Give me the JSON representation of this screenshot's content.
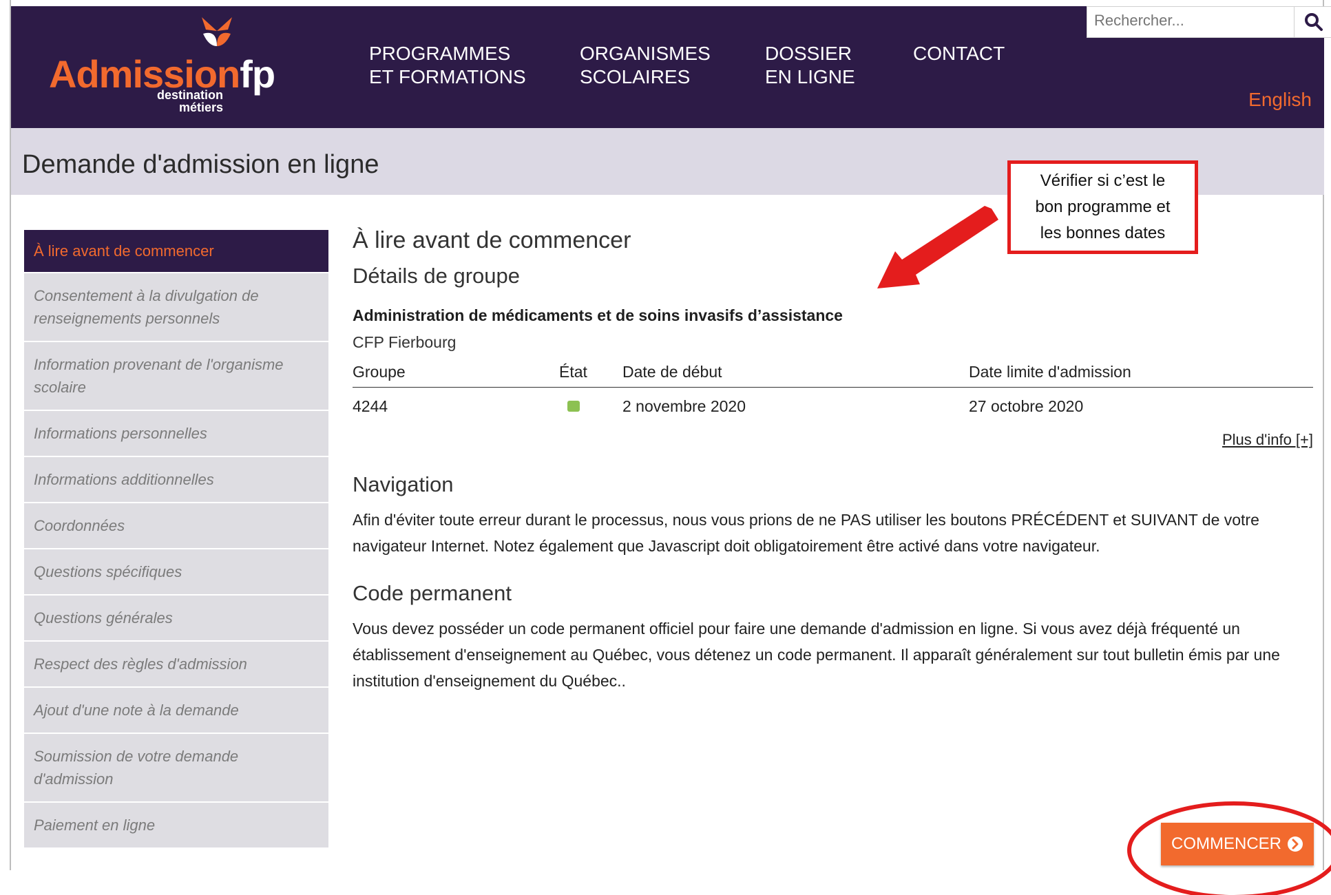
{
  "header": {
    "logo": {
      "word_main": "Admission",
      "word_fp": "fp",
      "sub_line1": "destination",
      "sub_line2": "métiers"
    },
    "nav": [
      {
        "line1": "PROGRAMMES",
        "line2": "ET FORMATIONS"
      },
      {
        "line1": "ORGANISMES",
        "line2": "SCOLAIRES"
      },
      {
        "line1": "DOSSIER",
        "line2": "EN LIGNE"
      },
      {
        "line1": "CONTACT",
        "line2": ""
      }
    ],
    "search": {
      "placeholder": "Rechercher...",
      "icon": "search-icon"
    },
    "language_link": "English",
    "colors": {
      "background": "#2d1b47",
      "accent": "#f26a2e"
    }
  },
  "page_title": "Demande d'admission en ligne",
  "sidebar": {
    "items": [
      {
        "label": "À lire avant de commencer",
        "active": true
      },
      {
        "label": "Consentement à la divulgation de renseignements personnels"
      },
      {
        "label": "Information provenant de l'organisme scolaire"
      },
      {
        "label": "Informations personnelles"
      },
      {
        "label": "Informations additionnelles"
      },
      {
        "label": "Coordonnées"
      },
      {
        "label": "Questions spécifiques"
      },
      {
        "label": "Questions générales"
      },
      {
        "label": "Respect des règles d'admission"
      },
      {
        "label": "Ajout d'une note à la demande"
      },
      {
        "label": "Soumission de votre demande d'admission"
      },
      {
        "label": "Paiement en ligne"
      }
    ]
  },
  "main": {
    "section_title": "À lire avant de commencer",
    "group_title": "Détails de groupe",
    "program_name": "Administration de médicaments et de soins invasifs d’assistance",
    "school": "CFP Fierbourg",
    "table": {
      "headers": [
        "Groupe",
        "État",
        "Date de début",
        "Date limite d'admission"
      ],
      "rows": [
        {
          "groupe": "4244",
          "etat_color": "#8cc152",
          "date_debut": "2 novembre 2020",
          "date_limite": "27 octobre 2020"
        }
      ]
    },
    "more_info": "Plus d'info [+]",
    "navigation_title": "Navigation",
    "navigation_text": "Afin d'éviter toute erreur durant le processus, nous vous prions de ne PAS utiliser les boutons PRÉCÉDENT et SUIVANT de votre navigateur Internet. Notez également que Javascript doit obligatoirement être activé dans votre navigateur.",
    "code_title": "Code permanent",
    "code_text": "Vous devez posséder un code permanent officiel pour faire une demande d'admission en ligne. Si vous avez déjà fréquenté un établissement d'enseignement au Québec, vous détenez un code permanent. Il apparaît généralement sur tout bulletin émis par une institution d'enseignement du Québec..",
    "start_button": "COMMENCER"
  },
  "annotation": {
    "line1": "Vérifier si c’est le",
    "line2": "bon programme et",
    "line3": "les bonnes dates",
    "color": "#e41d1d"
  }
}
